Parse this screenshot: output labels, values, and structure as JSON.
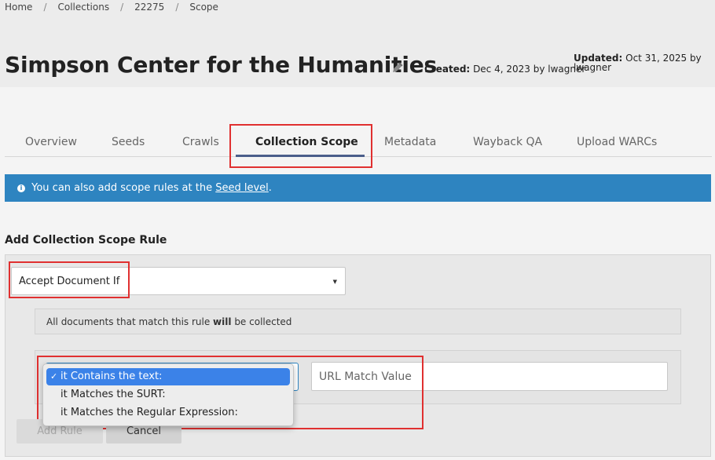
{
  "breadcrumb": {
    "items": [
      "Home",
      "Collections",
      "22275",
      "Scope"
    ],
    "separator": "/"
  },
  "collection": {
    "title": "Simpson Center for the Humanities",
    "created_label": "Created:",
    "created_value": "Dec 4, 2023 by lwagner",
    "updated_label": "Updated:",
    "updated_value": "Oct 31, 2025 by lwagner"
  },
  "tabs": [
    {
      "label": "Overview",
      "active": false
    },
    {
      "label": "Seeds",
      "active": false
    },
    {
      "label": "Crawls",
      "active": false
    },
    {
      "label": "Collection Scope",
      "active": true
    },
    {
      "label": "Metadata",
      "active": false
    },
    {
      "label": "Wayback QA",
      "active": false
    },
    {
      "label": "Upload WARCs",
      "active": false
    }
  ],
  "info_alert": {
    "icon": "info-circle-icon",
    "text_before": "You can also add scope rules at the",
    "link_text": "Seed level",
    "text_after": "."
  },
  "scope_form": {
    "section_title": "Add Collection Scope Rule",
    "action_select_value": "Accept Document If",
    "rule_desc_before": "All documents that match this rule",
    "rule_desc_bold": "will",
    "rule_desc_after": "be collected",
    "url_placeholder": "URL Match Value",
    "add_button": "Add Rule",
    "cancel_button": "Cancel"
  },
  "condition_dropdown": {
    "options": [
      {
        "label": "it Contains the text:",
        "selected": true
      },
      {
        "label": "it Matches the SURT:",
        "selected": false
      },
      {
        "label": "it Matches the Regular Expression:",
        "selected": false
      }
    ]
  },
  "colors": {
    "alert_bg": "#2e84c0",
    "tab_underline": "#4a5e8a",
    "highlight_box": "#e03030",
    "dropdown_selected": "#3b82e8"
  }
}
